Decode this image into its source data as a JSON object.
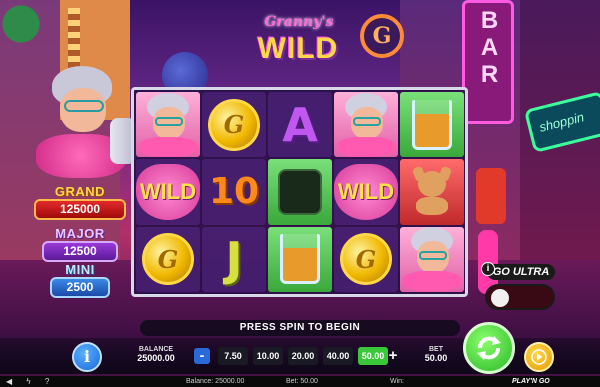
{
  "logo": {
    "line1": "Granny's",
    "line2": "WILD"
  },
  "background": {
    "bar_sign": "BAR",
    "shop_sign": "shoppin",
    "g_sign": "G"
  },
  "jackpots": [
    {
      "name": "GRAND",
      "value": "125000"
    },
    {
      "name": "MAJOR",
      "value": "12500"
    },
    {
      "name": "MINI",
      "value": "2500"
    }
  ],
  "reels": {
    "rows": [
      [
        {
          "symbol": "granny"
        },
        {
          "symbol": "coin",
          "glyph": "G"
        },
        {
          "symbol": "letter-a",
          "text": "A"
        },
        {
          "symbol": "granny"
        },
        {
          "symbol": "whisky-glass"
        }
      ],
      [
        {
          "symbol": "wild",
          "text": "WILD"
        },
        {
          "symbol": "ten",
          "text": "10"
        },
        {
          "symbol": "money-bag"
        },
        {
          "symbol": "wild",
          "text": "WILD"
        },
        {
          "symbol": "chihuahua"
        }
      ],
      [
        {
          "symbol": "coin",
          "glyph": "G"
        },
        {
          "symbol": "letter-j",
          "text": "J"
        },
        {
          "symbol": "whisky-glass"
        },
        {
          "symbol": "coin",
          "glyph": "G"
        },
        {
          "symbol": "granny"
        }
      ]
    ]
  },
  "go_ultra": {
    "info_glyph": "i",
    "label": "GO ULTRA",
    "enabled": false
  },
  "message": "PRESS SPIN TO BEGIN",
  "controls": {
    "info_glyph": "i",
    "balance_label": "BALANCE",
    "balance_value": "25000.00",
    "minus": "-",
    "plus": "+",
    "bet_options": [
      "7.50",
      "10.00",
      "20.00",
      "40.00",
      "50.00"
    ],
    "selected_bet": "50.00",
    "bet_label": "BET",
    "bet_value": "50.00"
  },
  "status_bar": {
    "icons": [
      "sound-icon",
      "lightning-icon",
      "help-icon"
    ],
    "icon_glyphs": "◀ ϟ ?",
    "balance": "Balance: 25000.00",
    "bet": "Bet: 50.00",
    "win": "Win:",
    "brand": "PLAY'N GO"
  },
  "colors": {
    "accent_green": "#3ac83a",
    "grand_red": "#e22a2a",
    "major_purple": "#9a3ad8",
    "mini_blue": "#3a8ae8"
  }
}
